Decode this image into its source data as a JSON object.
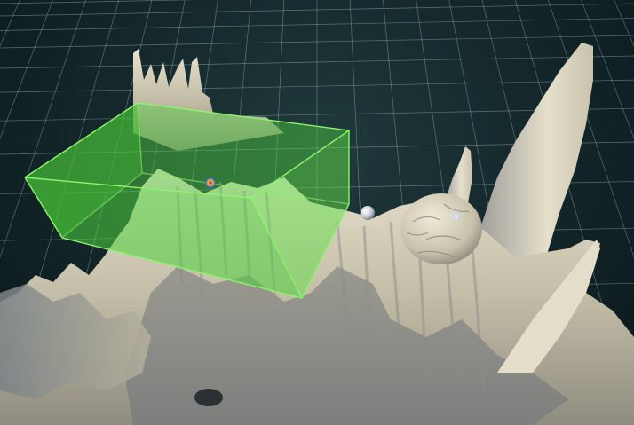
{
  "viewport": {
    "background_color": "#15292d",
    "grid_color": "#b8c6c8",
    "grid_visible": true
  },
  "terrain": {
    "color": "#bfb8a3",
    "shadow_color": "#5c6a72",
    "highlight_color": "#e6e0cd"
  },
  "selection_volume": {
    "color": "#4fd13e",
    "edge_color": "#8cf46e",
    "opacity": 0.6
  },
  "markers": [
    {
      "icon": "object-gizmo-icon",
      "color": "#d9a640"
    },
    {
      "icon": "sphere-object-icon",
      "color": "#e4e8ec"
    },
    {
      "icon": "light-point-icon",
      "color": "#cfe4ff"
    }
  ]
}
